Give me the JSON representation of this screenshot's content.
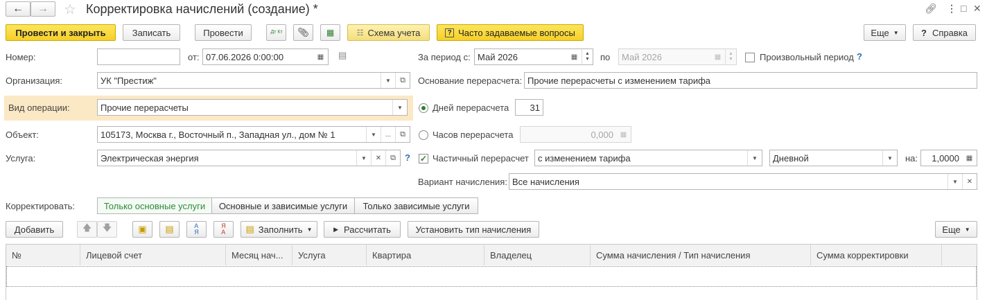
{
  "title": "Корректировка начислений (создание) *",
  "toolbar": {
    "post_close": "Провести и закрыть",
    "save": "Записать",
    "post": "Провести",
    "dtkt": "Дт Кт",
    "scheme": "Схема учета",
    "faq": "Часто задаваемые вопросы",
    "more": "Еще",
    "help": "Справка"
  },
  "form": {
    "number_label": "Номер:",
    "number_value": "",
    "from_label": "от:",
    "date_value": "07.06.2026  0:00:00",
    "period_label": "За период с:",
    "period_from": "Май 2026",
    "period_to_label": "по",
    "period_to": "Май 2026",
    "arbitrary_period_label": "Произвольный период",
    "org_label": "Организация:",
    "org_value": "УК \"Престиж\"",
    "reason_label": "Основание перерасчета:",
    "reason_value": "Прочие перерасчеты с изменением тарифа",
    "optype_label": "Вид операции:",
    "optype_value": "Прочие перерасчеты",
    "days_label": "Дней перерасчета",
    "days_value": "31",
    "object_label": "Объект:",
    "object_value": "105173, Москва г., Восточный п., Западная ул., дом № 1",
    "hours_label": "Часов перерасчета",
    "hours_value": "0,000",
    "service_label": "Услуга:",
    "service_value": "Электрическая энергия",
    "partial_label": "Частичный перерасчет",
    "partial_mode": "с изменением тарифа",
    "partial_period": "Дневной",
    "coef_label": "на:",
    "coef_value": "1,0000",
    "variant_label": "Вариант начисления:",
    "variant_value": "Все начисления",
    "correct_label": "Корректировать:",
    "segments": [
      "Только основные услуги",
      "Основные и зависимые услуги",
      "Только зависимые услуги"
    ]
  },
  "table_toolbar": {
    "add": "Добавить",
    "fill": "Заполнить",
    "calc": "Рассчитать",
    "set_type": "Установить тип начисления",
    "more": "Еще"
  },
  "table": {
    "columns": [
      "№",
      "Лицевой счет",
      "Месяц нач...",
      "Услуга",
      "Квартира",
      "Владелец",
      "Сумма начисления / Тип начисления",
      "Сумма корректировки"
    ]
  },
  "icons": {
    "back": "back-arrow-icon",
    "forward": "forward-arrow-icon",
    "star": "star-icon",
    "link": "link-icon",
    "menu": "kebab-menu-icon",
    "maximize": "maximize-icon",
    "close": "close-icon"
  },
  "colors": {
    "primary_button": "#f6d028",
    "active_segment_text": "#2e8b3a",
    "highlight_row": "#fbe8c4",
    "help_mark": "#2f6fb3"
  }
}
